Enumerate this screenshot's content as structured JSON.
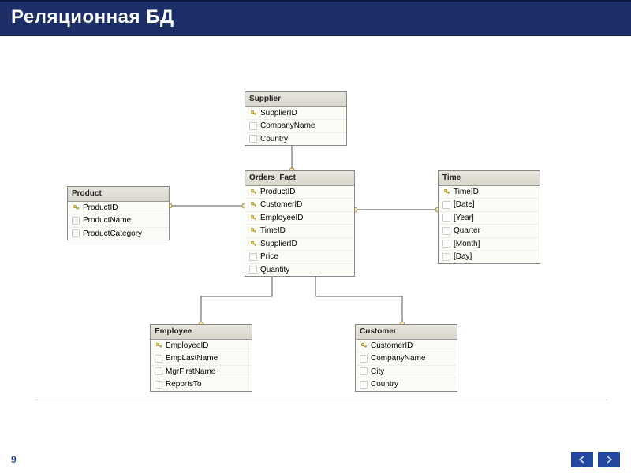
{
  "header": {
    "title": "Реляционная БД"
  },
  "page_number": "9",
  "tables": {
    "supplier": {
      "title": "Supplier",
      "rows": [
        {
          "key": true,
          "label": "SupplierID"
        },
        {
          "key": false,
          "label": "CompanyName"
        },
        {
          "key": false,
          "label": "Country"
        }
      ]
    },
    "product": {
      "title": "Product",
      "rows": [
        {
          "key": true,
          "label": "ProductID"
        },
        {
          "key": false,
          "label": "ProductName"
        },
        {
          "key": false,
          "label": "ProductCategory"
        }
      ]
    },
    "orders_fact": {
      "title": "Orders_Fact",
      "rows": [
        {
          "key": true,
          "label": "ProductID"
        },
        {
          "key": true,
          "label": "CustomerID"
        },
        {
          "key": true,
          "label": "EmployeeID"
        },
        {
          "key": true,
          "label": "TimeID"
        },
        {
          "key": true,
          "label": "SupplierID"
        },
        {
          "key": false,
          "label": "Price"
        },
        {
          "key": false,
          "label": "Quantity"
        }
      ]
    },
    "time": {
      "title": "Time",
      "rows": [
        {
          "key": true,
          "label": "TimeID"
        },
        {
          "key": false,
          "label": "[Date]"
        },
        {
          "key": false,
          "label": "[Year]"
        },
        {
          "key": false,
          "label": "Quarter"
        },
        {
          "key": false,
          "label": "[Month]"
        },
        {
          "key": false,
          "label": "[Day]"
        }
      ]
    },
    "employee": {
      "title": "Employee",
      "rows": [
        {
          "key": true,
          "label": "EmployeeID"
        },
        {
          "key": false,
          "label": "EmpLastName"
        },
        {
          "key": false,
          "label": "MgrFirstName"
        },
        {
          "key": false,
          "label": "ReportsTo"
        }
      ]
    },
    "customer": {
      "title": "Customer",
      "rows": [
        {
          "key": true,
          "label": "CustomerID"
        },
        {
          "key": false,
          "label": "CompanyName"
        },
        {
          "key": false,
          "label": "City"
        },
        {
          "key": false,
          "label": "Country"
        }
      ]
    }
  },
  "relationships": [
    {
      "from": "supplier",
      "to": "orders_fact"
    },
    {
      "from": "product",
      "to": "orders_fact"
    },
    {
      "from": "time",
      "to": "orders_fact"
    },
    {
      "from": "employee",
      "to": "orders_fact"
    },
    {
      "from": "customer",
      "to": "orders_fact"
    }
  ]
}
